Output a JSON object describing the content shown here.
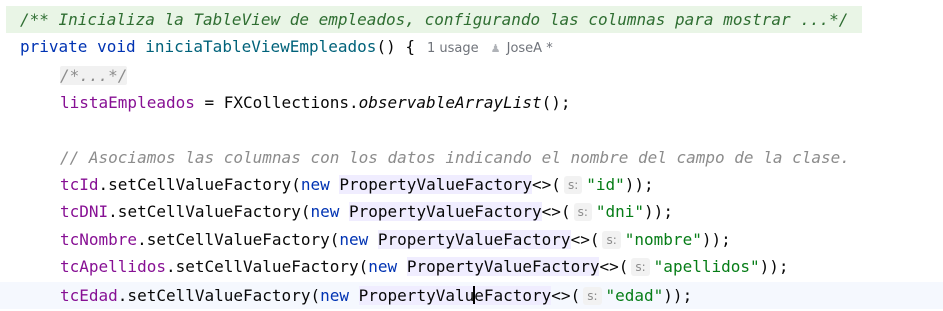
{
  "editor": {
    "lines": {
      "doc_comment": "/** Inicializa la TableView de empleados, configurando las columnas para mostrar ...*/",
      "signature": {
        "kw_private": "private",
        "kw_void": "void",
        "method_name": "iniciaTableViewEmpleados",
        "rest": "() {",
        "usages": "1 usage",
        "author": "JoseA *"
      },
      "folded_comment": "/*...*/",
      "assign": {
        "field": "listaEmpleados",
        "mid": " = FXCollections.",
        "call": "observableArrayList",
        "end": "();"
      },
      "comment": "// Asociamos las columnas con los datos indicando el nombre del campo de la clase.",
      "factories": [
        {
          "field": "tcId",
          "string": "\"id\""
        },
        {
          "field": "tcDNI",
          "string": "\"dni\""
        },
        {
          "field": "tcNombre",
          "string": "\"nombre\""
        },
        {
          "field": "tcApellidos",
          "string": "\"apellidos\""
        },
        {
          "field": "tcEdad",
          "string": "\"edad\""
        }
      ],
      "setter": ".setCellValueFactory(",
      "kw_new": "new",
      "type_name": "PropertyValueFactory",
      "type_name_part1": "PropertyValu",
      "type_name_part2": "eFactory",
      "diamond": "<>(",
      "param_hint": "s:",
      "close": "));"
    }
  }
}
